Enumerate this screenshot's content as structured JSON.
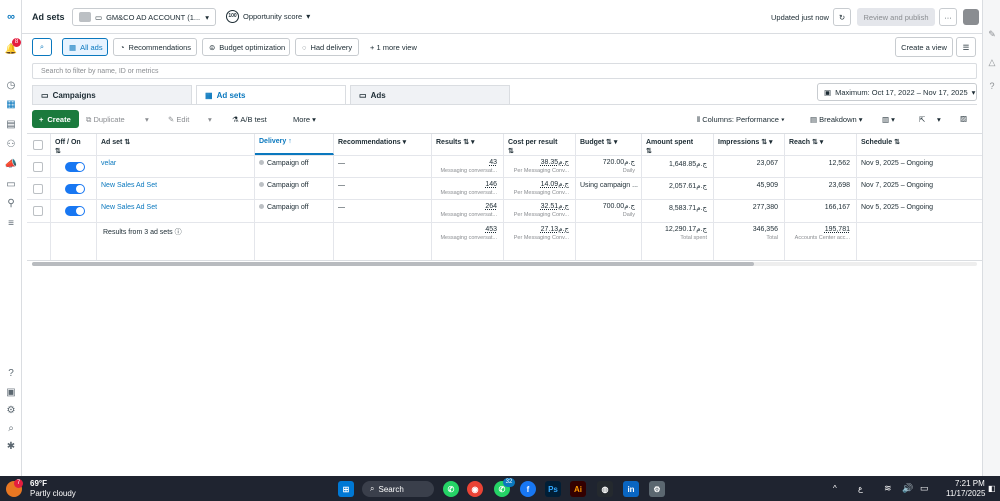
{
  "header": {
    "title": "Ad sets",
    "account": "GM&CO AD ACCOUNT (1...",
    "opportunity_score": "100",
    "opportunity_label": "Opportunity score",
    "updated": "Updated just now",
    "review_publish": "Review and publish",
    "more": "···",
    "notification_count": "8"
  },
  "filters": {
    "all_ads": "All ads",
    "recommendations": "Recommendations",
    "budget_optimization": "Budget optimization",
    "had_delivery": "Had delivery",
    "more_view": "+ 1 more view",
    "create_view": "Create a view",
    "search_placeholder": "Search to filter by name, ID or metrics"
  },
  "tabs": [
    {
      "label": "Campaigns"
    },
    {
      "label": "Ad sets"
    },
    {
      "label": "Ads"
    }
  ],
  "date_range": "Maximum: Oct 17, 2022 – Nov 17, 2025",
  "toolbar": {
    "create": "Create",
    "duplicate": "Duplicate",
    "edit": "Edit",
    "ab_test": "A/B test",
    "more": "More",
    "columns": "Columns: Performance",
    "breakdown": "Breakdown"
  },
  "columns": [
    "Off / On",
    "Ad set",
    "Delivery",
    "Recommendations",
    "Results",
    "Cost per result",
    "Budget",
    "Amount spent",
    "Impressions",
    "Reach",
    "Schedule"
  ],
  "rows": [
    {
      "name": "velar",
      "delivery": "Campaign off",
      "recommendations": "—",
      "results": "43",
      "results_sub": "Messaging conversat...",
      "cpr": "38.35ج.م",
      "cpr_sub": "Per Messaging Conv...",
      "budget": "720.00ج.م",
      "budget_sub": "Daily",
      "spent": "1,648.85ج.م",
      "impressions": "23,067",
      "reach": "12,562",
      "schedule": "Nov 9, 2025 – Ongoing"
    },
    {
      "name": "New Sales Ad Set",
      "delivery": "Campaign off",
      "recommendations": "—",
      "results": "146",
      "results_sub": "Messaging conversat...",
      "cpr": "14.09ج.م",
      "cpr_sub": "Per Messaging Conv...",
      "budget": "Using campaign ...",
      "budget_sub": "",
      "spent": "2,057.61ج.م",
      "impressions": "45,909",
      "reach": "23,698",
      "schedule": "Nov 7, 2025 – Ongoing"
    },
    {
      "name": "New Sales Ad Set",
      "delivery": "Campaign off",
      "recommendations": "—",
      "results": "264",
      "results_sub": "Messaging conversat...",
      "cpr": "32.51ج.م",
      "cpr_sub": "Per Messaging Conv...",
      "budget": "700.00ج.م",
      "budget_sub": "Daily",
      "spent": "8,583.71ج.م",
      "impressions": "277,380",
      "reach": "166,167",
      "schedule": "Nov 5, 2025 – Ongoing"
    }
  ],
  "totals": {
    "label": "Results from 3 ad sets",
    "results": "453",
    "results_sub": "Messaging conversat...",
    "cpr": "27.13ج.م",
    "cpr_sub": "Per Messaging Conv...",
    "spent": "12,290.17ج.م",
    "spent_sub": "Total spent",
    "impressions": "346,356",
    "impressions_sub": "Total",
    "reach": "195,781",
    "reach_sub": "Accounts Center acc..."
  },
  "taskbar": {
    "weather_temp": "69°F",
    "weather_desc": "Partly cloudy",
    "weather_badge": "7",
    "search": "Search",
    "whatsapp_badge": "32",
    "lang": "ع",
    "time": "7:21 PM",
    "date": "11/17/2025"
  },
  "colors": {
    "accent": "#0a78be",
    "create": "#1b7a3d",
    "toggle": "#1877f2"
  }
}
